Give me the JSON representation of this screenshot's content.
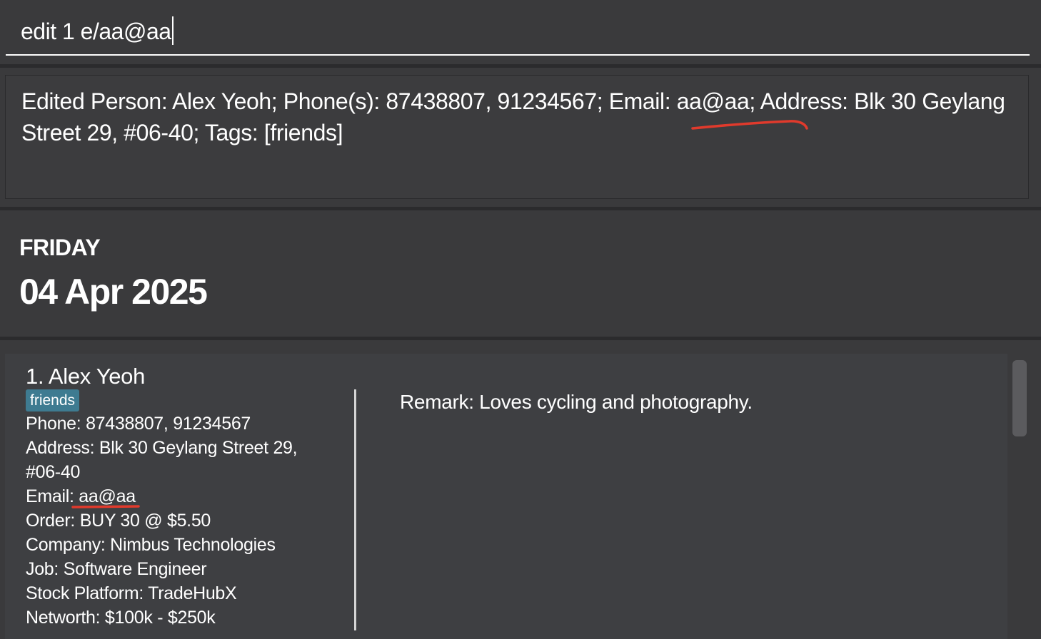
{
  "command_box": {
    "value": "edit 1 e/aa@aa"
  },
  "result_display": {
    "text": "Edited Person: Alex Yeoh; Phone(s): 87438807, 91234567; Email: aa@aa; Address: Blk 30 Geylang Street 29, #06-40; Tags: [friends]"
  },
  "date_panel": {
    "day": "FRIDAY",
    "date": "04 Apr 2025"
  },
  "person_list": [
    {
      "name": "1. Alex Yeoh",
      "tags": [
        "friends"
      ],
      "phone": "Phone: 87438807, 91234567",
      "address_line1": "Address: Blk 30 Geylang Street 29,",
      "address_line2": "#06-40",
      "email": "Email: aa@aa",
      "order": "Order: BUY 30 @ $5.50",
      "company": "Company: Nimbus Technologies",
      "job": "Job: Software Engineer",
      "stock_platform": "Stock Platform: TradeHubX",
      "networth": "Networth: $100k - $250k",
      "remark": "Remark: Loves cycling and photography."
    }
  ],
  "colors": {
    "background": "#3a3a3c",
    "card": "#3e3f42",
    "tag": "#3e7b91",
    "annotation": "#e03a2c"
  }
}
